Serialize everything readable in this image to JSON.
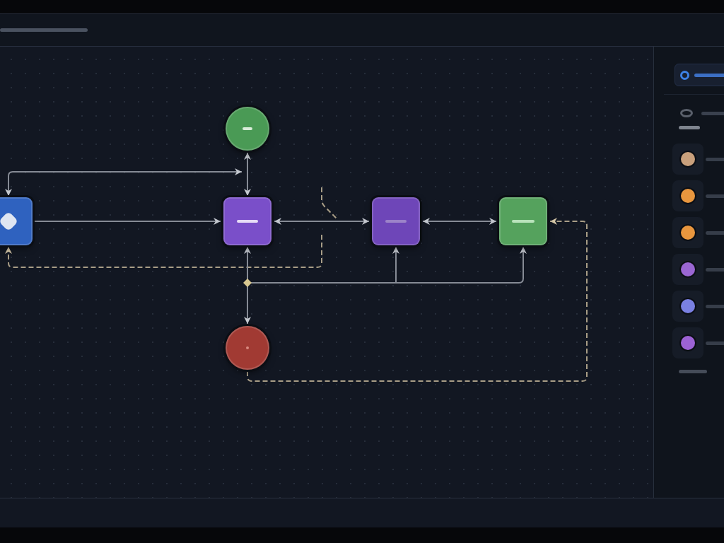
{
  "canvas": {
    "nodes": [
      {
        "kind": "square",
        "color": "#2f62bf"
      },
      {
        "kind": "circle",
        "color": "#4a9a55"
      },
      {
        "kind": "square",
        "color": "#7a4fc9"
      },
      {
        "kind": "square",
        "color": "#6e46b8"
      },
      {
        "kind": "square",
        "color": "#55a25d"
      },
      {
        "kind": "circle",
        "color": "#a13a33"
      }
    ],
    "edges": [
      {
        "kind": "solid",
        "arrow_start": false,
        "arrow_end": true
      },
      {
        "kind": "solid",
        "arrow_start": true,
        "arrow_end": true
      },
      {
        "kind": "solid",
        "arrow_start": true,
        "arrow_end": true
      },
      {
        "kind": "dashed",
        "arrow_start": false,
        "arrow_end": true
      },
      {
        "kind": "dashed",
        "arrow_start": false,
        "arrow_end": false
      },
      {
        "kind": "solid",
        "arrow_start": true,
        "arrow_end": true
      },
      {
        "kind": "solid",
        "arrow_start": true,
        "arrow_end": true
      },
      {
        "kind": "solid",
        "arrow_start": true,
        "arrow_end": true
      },
      {
        "kind": "solid",
        "arrow_start": false,
        "arrow_end": true
      },
      {
        "kind": "solid",
        "arrow_start": false,
        "arrow_end": true
      },
      {
        "kind": "dashed",
        "arrow_start": false,
        "arrow_end": true
      }
    ]
  },
  "palette": {
    "items": [
      {
        "color": "#c9a07c"
      },
      {
        "color": "#e8963e"
      },
      {
        "color": "#e8963e"
      },
      {
        "color": "#9a66d2"
      },
      {
        "color": "#7a80e2"
      },
      {
        "color": "#9c62d4"
      }
    ]
  }
}
